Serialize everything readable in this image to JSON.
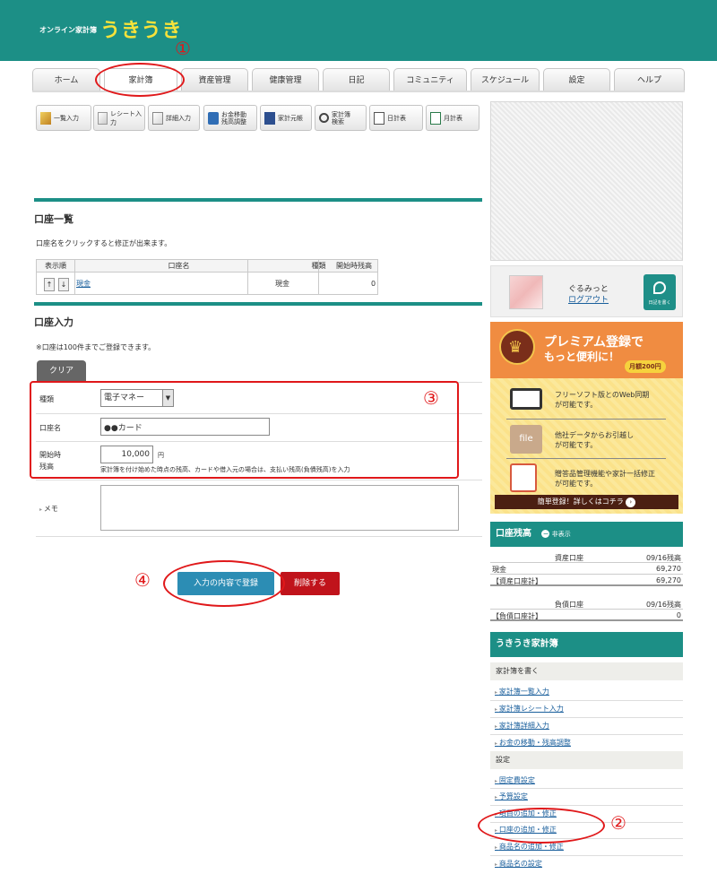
{
  "header": {
    "subtitle": "オンライン家計簿",
    "logo": "うきうき"
  },
  "tabs": [
    "ホーム",
    "家計簿",
    "資産管理",
    "健康管理",
    "日記",
    "コミュニティ",
    "スケジュール",
    "設定",
    "ヘルプ"
  ],
  "toolbar": [
    "一覧入力",
    "レシート入力",
    "詳細入力",
    "お金移動\n残高調整",
    "家計元帳",
    "家計簿\n検索",
    "日計表",
    "月計表"
  ],
  "account_list": {
    "title": "口座一覧",
    "note": "口座名をクリックすると修正が出来ます。",
    "headers": [
      "表示順",
      "口座名",
      "種類",
      "開始時残高"
    ],
    "rows": [
      {
        "up": "↑",
        "down": "↓",
        "name": "現金",
        "type": "現金",
        "balance": "0"
      }
    ]
  },
  "account_input": {
    "title": "口座入力",
    "note": "※口座は100件までご登録できます。",
    "clear_label": "クリア",
    "type_label": "種類",
    "type_value": "電子マネー",
    "name_label": "口座名",
    "name_value": "●●カード",
    "start_label_1": "開始時",
    "start_label_2": "残高",
    "start_value": "10,000",
    "start_unit": "円",
    "hint": "家計簿を付け始めた時点の残高、カードや借入元の場合は、支払い残高(負債残高)を入力",
    "memo_label": "メモ",
    "submit_label": "入力の内容で登録",
    "delete_label": "削除する"
  },
  "user": {
    "name": "ぐるみっと",
    "logout": "ログアウト",
    "diary_button": "日記を書く"
  },
  "premium": {
    "title": "プレミアム登録で",
    "subtitle": "もっと便利に！",
    "price": "月額200円",
    "features": [
      "フリーソフト版とのWeb同期\nが可能です。",
      "他社データからお引越し\nが可能です。",
      "贈答品管理機能や家計一括修正\nが可能です。"
    ],
    "file_label": "file",
    "button": "簡単登録！詳しくはコチラ"
  },
  "balance": {
    "title": "口座残高",
    "hide": "非表示",
    "asset_header": "資産口座",
    "asset_date": "09/16残高",
    "cash_label": "現金",
    "cash_value": "69,270",
    "asset_total_label": "【資産口座計】",
    "asset_total_value": "69,270",
    "debt_header": "負債口座",
    "debt_date": "09/16残高",
    "debt_total_label": "【負債口座計】",
    "debt_total_value": "0"
  },
  "sidebar": {
    "title": "うきうき家計簿",
    "cat_write": "家計簿を書く",
    "write_links": [
      "家計簿一覧入力",
      "家計簿レシート入力",
      "家計簿詳細入力",
      "お金の移動・残高調整"
    ],
    "cat_settings": "設定",
    "setting_links": [
      "固定費設定",
      "予算設定",
      "項目の追加・修正",
      "口座の追加・修正",
      "商品名の追加・修正",
      "商品名の設定"
    ]
  },
  "annotations": [
    "①",
    "②",
    "③",
    "④"
  ]
}
